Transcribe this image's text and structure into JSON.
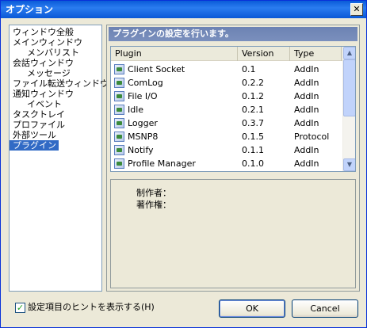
{
  "window": {
    "title": "オプション",
    "close_glyph": "✕"
  },
  "tree": {
    "items": [
      {
        "label": "ウィンドウ全般",
        "level": 0,
        "selected": false
      },
      {
        "label": "メインウィンドウ",
        "level": 0,
        "selected": false
      },
      {
        "label": "メンバリスト",
        "level": 1,
        "selected": false
      },
      {
        "label": "会話ウィンドウ",
        "level": 0,
        "selected": false
      },
      {
        "label": "メッセージ",
        "level": 1,
        "selected": false
      },
      {
        "label": "ファイル転送ウィンドウ",
        "level": 0,
        "selected": false
      },
      {
        "label": "通知ウィンドウ",
        "level": 0,
        "selected": false
      },
      {
        "label": "イベント",
        "level": 1,
        "selected": false
      },
      {
        "label": "タスクトレイ",
        "level": 0,
        "selected": false
      },
      {
        "label": "プロファイル",
        "level": 0,
        "selected": false
      },
      {
        "label": "外部ツール",
        "level": 0,
        "selected": false
      },
      {
        "label": "プラグイン",
        "level": 0,
        "selected": true
      }
    ]
  },
  "panel": {
    "header": "プラグインの設定を行います。"
  },
  "plugins": {
    "columns": [
      "Plugin",
      "Version",
      "Type"
    ],
    "rows": [
      {
        "name": "Client Socket",
        "version": "0.1",
        "type": "AddIn"
      },
      {
        "name": "ComLog",
        "version": "0.2.2",
        "type": "AddIn"
      },
      {
        "name": "File I/O",
        "version": "0.1.2",
        "type": "AddIn"
      },
      {
        "name": "Idle",
        "version": "0.2.1",
        "type": "AddIn"
      },
      {
        "name": "Logger",
        "version": "0.3.7",
        "type": "AddIn"
      },
      {
        "name": "MSNP8",
        "version": "0.1.5",
        "type": "Protocol"
      },
      {
        "name": "Notify",
        "version": "0.1.1",
        "type": "AddIn"
      },
      {
        "name": "Profile Manager",
        "version": "0.1.0",
        "type": "AddIn"
      }
    ],
    "scroll_up": "▲",
    "scroll_down": "▼"
  },
  "details": {
    "author_label": "制作者：",
    "copyright_label": "著作権："
  },
  "footer": {
    "hint_label": "設定項目のヒントを表示する(H)",
    "hint_checked": true,
    "check_glyph": "✓",
    "ok_label": "OK",
    "cancel_label": "Cancel"
  }
}
